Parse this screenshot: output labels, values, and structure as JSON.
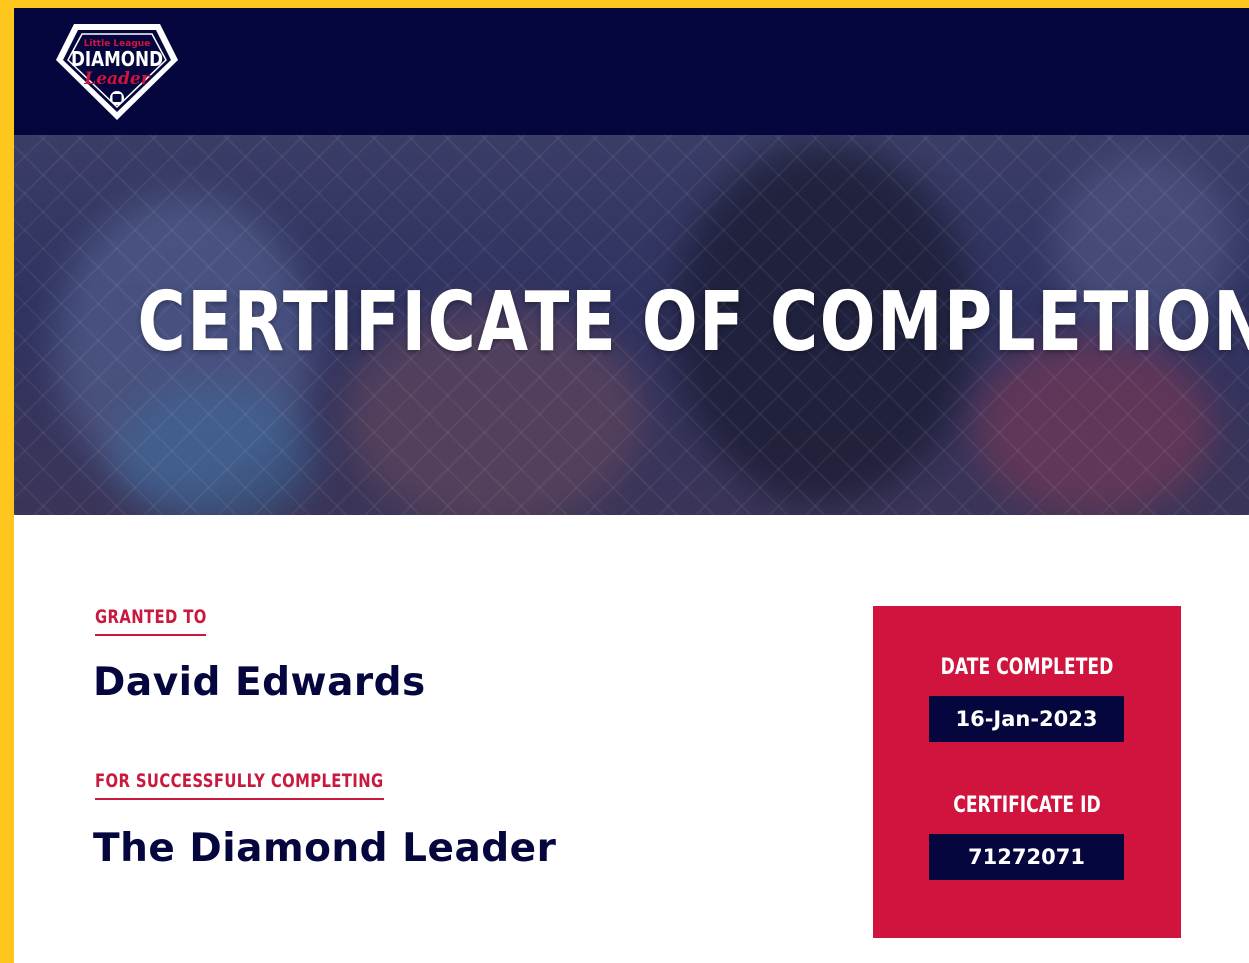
{
  "logo": {
    "top_text": "Little League",
    "main_text": "DIAMOND",
    "script_text": "Leader",
    "icon": "diamond-shield-icon"
  },
  "hero": {
    "title": "CERTIFICATE OF COMPLETION"
  },
  "granted": {
    "label": "GRANTED TO",
    "name": "David Edwards"
  },
  "completing": {
    "label": "FOR SUCCESSFULLY COMPLETING",
    "course": "The Diamond Leader"
  },
  "details": {
    "date_label": "DATE COMPLETED",
    "date_value": "16-Jan-2023",
    "id_label": "CERTIFICATE ID",
    "id_value": "71272071"
  },
  "colors": {
    "navy": "#05063E",
    "red": "#D0143E",
    "border": "#FFC61E"
  }
}
